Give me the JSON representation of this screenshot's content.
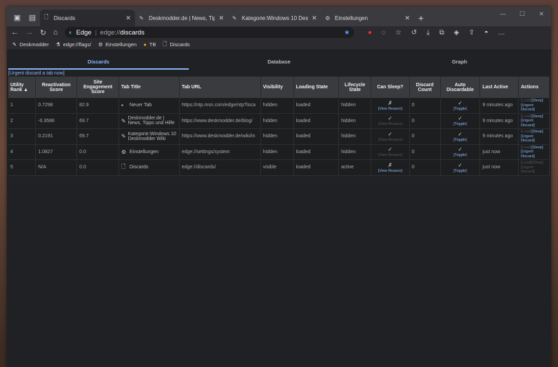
{
  "browser": {
    "tabs": [
      {
        "title": "Discards",
        "icon": "page-icon",
        "active": true
      },
      {
        "title": "Deskmodder.de | News, Tipps und Hilfe",
        "icon": "deskmodder-icon"
      },
      {
        "title": "Kategorie:Windows 10 Deskmodder Wiki",
        "icon": "deskmodder-icon"
      },
      {
        "title": "Einstellungen",
        "icon": "gear-icon"
      }
    ],
    "address": {
      "brand": "Edge",
      "scheme": "edge://",
      "host": "discards"
    },
    "bookmarks": [
      {
        "label": "Deskmodder",
        "icon": "deskmodder-icon"
      },
      {
        "label": "edge://flags/",
        "icon": "flask-icon"
      },
      {
        "label": "Einstellungen",
        "icon": "gear-icon"
      },
      {
        "label": "TB",
        "icon": "tb-icon"
      },
      {
        "label": "Discards",
        "icon": "page-icon"
      }
    ]
  },
  "discards": {
    "tabs": [
      "Discards",
      "Database",
      "Graph"
    ],
    "urgent_link": "[Urgent discard a tab now]",
    "headers": [
      "Utility Rank ▲",
      "Reactivation Score",
      "Site Engagement Score",
      "Tab Title",
      "Tab URL",
      "Visibility",
      "Loading State",
      "Lifecycle State",
      "Can Sleep?",
      "Discard Count",
      "Auto Discardable",
      "Last Active",
      "Actions"
    ],
    "rows": [
      {
        "rank": "1",
        "react": "0.7298",
        "engage": "82.9",
        "title": "Neuer Tab",
        "url": "https://ntp.msn.com/edge/ntp?loca",
        "vis": "hidden",
        "load": "loaded",
        "life": "hidden",
        "sleep": "✗",
        "count": "0",
        "auto": "✓",
        "last": "9 minutes ago"
      },
      {
        "rank": "2",
        "react": "-0.3588",
        "engage": "69.7",
        "title": "Deskmodder.de | News, Tipps und Hilfe",
        "url": "https://www.deskmodder.de/blog/",
        "vis": "hidden",
        "load": "loaded",
        "life": "hidden",
        "sleep": "✓",
        "count": "0",
        "auto": "✓",
        "last": "9 minutes ago"
      },
      {
        "rank": "3",
        "react": "0.2191",
        "engage": "69.7",
        "title": "Kategorie:Windows 10 Deskmodder Wiki",
        "url": "https://www.deskmodder.de/wiki/in",
        "vis": "hidden",
        "load": "loaded",
        "life": "hidden",
        "sleep": "✓",
        "count": "0",
        "auto": "✓",
        "last": "9 minutes ago"
      },
      {
        "rank": "4",
        "react": "1.0827",
        "engage": "0.0",
        "title": "Einstellungen",
        "url": "edge://settings/system",
        "vis": "hidden",
        "load": "loaded",
        "life": "hidden",
        "sleep": "✓",
        "count": "0",
        "auto": "✓",
        "last": "just now"
      },
      {
        "rank": "5",
        "react": "N/A",
        "engage": "0.0",
        "title": "Discards",
        "url": "edge://discards/",
        "vis": "visible",
        "load": "loaded",
        "life": "active",
        "sleep": "✗",
        "count": "0",
        "auto": "✓",
        "last": "just now"
      }
    ],
    "view_reason": "[View Reason]",
    "toggle": "[Toggle]",
    "actions": {
      "load": "[Load]",
      "sleep": "[Sleep]",
      "urgent": "[Urgent Discard]"
    }
  }
}
